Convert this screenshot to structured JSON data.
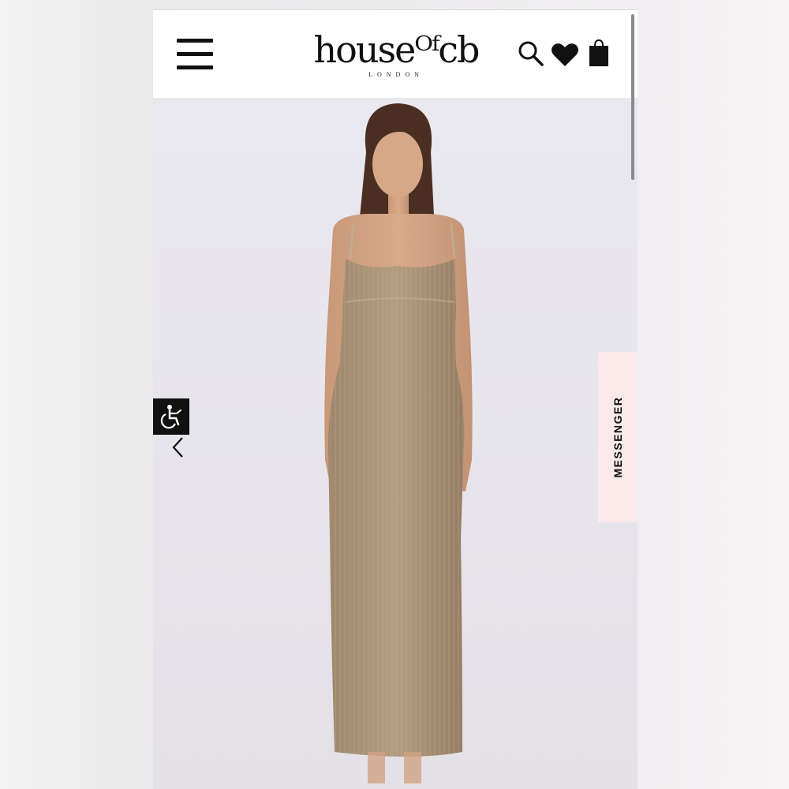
{
  "header": {
    "brand_name": "house of cb",
    "brand_display": "houseᴼᶠcb",
    "brand_location": "LONDON",
    "icons": [
      "menu-icon",
      "search-icon",
      "heart-icon",
      "shopping-bag-icon"
    ]
  },
  "product": {
    "image": "model-wearing-sequin-maxi-dress"
  },
  "overlays": {
    "accessibility_icon": "wheelchair-icon",
    "prev_arrow_icon": "chevron-left-icon",
    "messenger_label": "MESSENGER"
  },
  "colors": {
    "header_bg": "#ffffff",
    "image_bg": "#e8e6ea",
    "messenger_bg": "#fbe9ea",
    "dress": "#a48d74"
  }
}
